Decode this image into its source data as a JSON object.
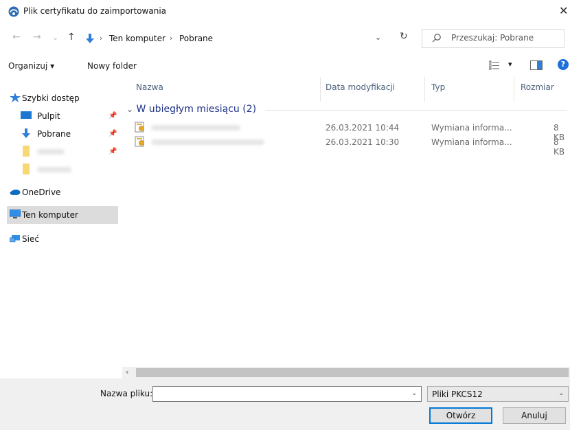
{
  "window": {
    "title": "Plik certyfikatu do zaimportowania",
    "close_glyph": "✕"
  },
  "address": {
    "back_glyph": "←",
    "forward_glyph": "→",
    "recent_glyph": "⌄",
    "up_glyph": "↑",
    "crumb_sep": "›",
    "crumbs": [
      "Ten komputer",
      "Pobrane"
    ],
    "dropdown_glyph": "⌄",
    "refresh_glyph": "↻",
    "search_placeholder": "Przeszukaj: Pobrane"
  },
  "toolbar": {
    "organize_label": "Organizuj ▾",
    "new_folder_label": "Nowy folder",
    "view_dd_glyph": "▾",
    "help_glyph": "?"
  },
  "nav": {
    "quick_access": "Szybki dostęp",
    "desktop": "Pulpit",
    "downloads": "Pobrane",
    "pin_glyph": "📌",
    "onedrive": "OneDrive",
    "this_pc": "Ten komputer",
    "network": "Sieć"
  },
  "columns": {
    "name": "Nazwa",
    "date": "Data modyfikacji",
    "type": "Typ",
    "size": "Rozmiar"
  },
  "group": {
    "label": "W ubiegłym miesiącu (2)",
    "chevron": "⌄"
  },
  "files": [
    {
      "date": "26.03.2021 10:44",
      "type": "Wymiana informa...",
      "size": "8 KB"
    },
    {
      "date": "26.03.2021 10:30",
      "type": "Wymiana informa...",
      "size": "8 KB"
    }
  ],
  "scroll": {
    "left_arrow": "‹"
  },
  "bottom": {
    "filename_label": "Nazwa pliku:",
    "filename_value": "",
    "dd_glyph": "⌄",
    "filetype_value": "Pliki PKCS12",
    "open_label": "Otwórz",
    "cancel_label": "Anuluj"
  }
}
